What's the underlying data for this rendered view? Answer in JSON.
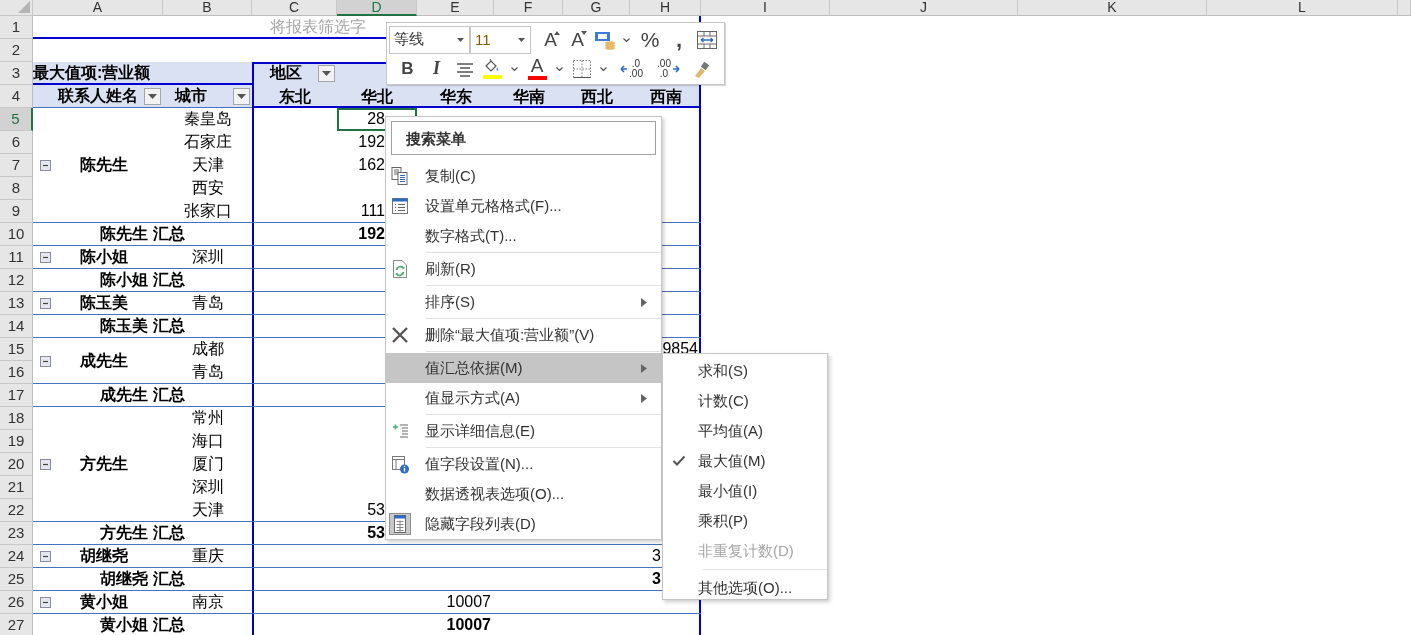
{
  "columns": [
    {
      "label": "A",
      "selected": false
    },
    {
      "label": "B",
      "selected": false
    },
    {
      "label": "C",
      "selected": false
    },
    {
      "label": "D",
      "selected": true
    },
    {
      "label": "E",
      "selected": false
    },
    {
      "label": "F",
      "selected": false
    },
    {
      "label": "G",
      "selected": false
    },
    {
      "label": "H",
      "selected": false
    },
    {
      "label": "I",
      "selected": false
    },
    {
      "label": "J",
      "selected": false
    },
    {
      "label": "K",
      "selected": false
    },
    {
      "label": "L",
      "selected": false
    }
  ],
  "rows": [
    {
      "label": "1",
      "selected": false
    },
    {
      "label": "2",
      "selected": false
    },
    {
      "label": "3",
      "selected": false
    },
    {
      "label": "4",
      "selected": false
    },
    {
      "label": "5",
      "selected": true
    },
    {
      "label": "6",
      "selected": false
    },
    {
      "label": "7",
      "selected": false
    },
    {
      "label": "8",
      "selected": false
    },
    {
      "label": "9",
      "selected": false
    },
    {
      "label": "10",
      "selected": false
    },
    {
      "label": "11",
      "selected": false
    },
    {
      "label": "12",
      "selected": false
    },
    {
      "label": "13",
      "selected": false
    },
    {
      "label": "14",
      "selected": false
    },
    {
      "label": "15",
      "selected": false
    },
    {
      "label": "16",
      "selected": false
    },
    {
      "label": "17",
      "selected": false
    },
    {
      "label": "18",
      "selected": false
    },
    {
      "label": "19",
      "selected": false
    },
    {
      "label": "20",
      "selected": false
    },
    {
      "label": "21",
      "selected": false
    },
    {
      "label": "22",
      "selected": false
    },
    {
      "label": "23",
      "selected": false
    },
    {
      "label": "24",
      "selected": false
    },
    {
      "label": "25",
      "selected": false
    },
    {
      "label": "26",
      "selected": false
    },
    {
      "label": "27",
      "selected": false
    }
  ],
  "pivot": {
    "filter_hint": "将报表筛选字",
    "value_field": "最大值项:营业额",
    "column_field": "地区",
    "row_fields": [
      "联系人姓名",
      "城市"
    ],
    "regions": [
      "东北",
      "华北",
      "华东",
      "华南",
      "西北",
      "西南"
    ],
    "groups": [
      {
        "name": "陈先生",
        "expanded": true,
        "items": [
          {
            "city": "秦皇岛",
            "values": {
              "region_2": "28"
            }
          },
          {
            "city": "石家庄",
            "values": {
              "region_2": "192"
            }
          },
          {
            "city": "天津",
            "values": {
              "region_2": "162"
            }
          },
          {
            "city": "西安"
          },
          {
            "city": "张家口",
            "values": {
              "region_2": "111"
            }
          }
        ],
        "subtotal": {
          "label": "陈先生 汇总",
          "values": {
            "region_2": "192"
          }
        }
      },
      {
        "name": "陈小姐",
        "expanded": true,
        "items": [
          {
            "city": "深圳"
          }
        ],
        "subtotal": {
          "label": "陈小姐 汇总"
        }
      },
      {
        "name": "陈玉美",
        "expanded": true,
        "items": [
          {
            "city": "青岛"
          }
        ],
        "subtotal": {
          "label": "陈玉美 汇总"
        }
      },
      {
        "name": "成先生",
        "expanded": true,
        "items": [
          {
            "city": "成都",
            "values": {
              "region_6": "9854"
            }
          },
          {
            "city": "青岛"
          }
        ],
        "subtotal": {
          "label": "成先生 汇总"
        }
      },
      {
        "name": "方先生",
        "expanded": true,
        "items": [
          {
            "city": "常州"
          },
          {
            "city": "海口"
          },
          {
            "city": "厦门"
          },
          {
            "city": "深圳"
          },
          {
            "city": "天津",
            "values": {
              "region_2": "53"
            }
          }
        ],
        "subtotal": {
          "label": "方先生 汇总",
          "values": {
            "region_2": "53"
          }
        }
      },
      {
        "name": "胡继尧",
        "expanded": true,
        "items": [
          {
            "city": "重庆",
            "values": {
              "region_6": "3"
            }
          }
        ],
        "subtotal": {
          "label": "胡继尧 汇总",
          "values": {
            "region_6": "3"
          }
        }
      },
      {
        "name": "黄小姐",
        "expanded": true,
        "items": [
          {
            "city": "南京",
            "values": {
              "region_3": "10007"
            }
          }
        ],
        "subtotal": {
          "label": "黄小姐 汇总",
          "values": {
            "region_3": "10007"
          }
        }
      }
    ]
  },
  "mini_toolbar": {
    "rows": [
      [
        {
          "kind": "font",
          "value": "等线"
        },
        {
          "kind": "size",
          "value": "11"
        },
        {
          "kind": "grow",
          "glyph": "A"
        },
        {
          "kind": "shrink",
          "glyph": "A"
        },
        {
          "kind": "accounting"
        },
        {
          "kind": "caret"
        },
        {
          "kind": "percent",
          "glyph": "%"
        },
        {
          "kind": "comma",
          "glyph": ","
        },
        {
          "kind": "wrap"
        }
      ],
      [
        {
          "kind": "bold",
          "glyph": "B"
        },
        {
          "kind": "italic",
          "glyph": "I"
        },
        {
          "kind": "align"
        },
        {
          "kind": "fill",
          "color": "#ffff00"
        },
        {
          "kind": "caret"
        },
        {
          "kind": "fontcolor",
          "glyph": "A",
          "color": "#ff0000"
        },
        {
          "kind": "caret"
        },
        {
          "kind": "borders"
        },
        {
          "kind": "caret"
        },
        {
          "kind": "incdecimal",
          "lines": [
            ".0",
            ".00"
          ]
        },
        {
          "kind": "decdecimal",
          "lines": [
            ".00",
            ".0"
          ]
        },
        {
          "kind": "painter"
        }
      ]
    ]
  },
  "context_menu": {
    "search": {
      "placeholder": "搜索菜单"
    },
    "items": [
      {
        "kind": "copy",
        "label": "复制(C)",
        "submenu": false,
        "selected": false,
        "checked": false
      },
      {
        "kind": "format",
        "label": "设置单元格格式(F)...",
        "submenu": false,
        "selected": false,
        "checked": false
      },
      {
        "kind": "plain",
        "label": "数字格式(T)...",
        "submenu": false,
        "selected": false,
        "checked": false
      },
      {
        "kind": "separator"
      },
      {
        "kind": "refresh",
        "label": "刷新(R)",
        "submenu": false,
        "selected": false,
        "checked": false
      },
      {
        "kind": "separator"
      },
      {
        "kind": "plain",
        "label": "排序(S)",
        "submenu": true,
        "selected": false,
        "checked": false
      },
      {
        "kind": "separator"
      },
      {
        "kind": "delete",
        "label": "删除“最大值项:营业额”(V)",
        "submenu": false,
        "selected": false,
        "checked": false
      },
      {
        "kind": "separator"
      },
      {
        "kind": "plain",
        "label": "值汇总依据(M)",
        "submenu": true,
        "selected": true,
        "checked": false
      },
      {
        "kind": "plain",
        "label": "值显示方式(A)",
        "submenu": true,
        "selected": false,
        "checked": false
      },
      {
        "kind": "separator"
      },
      {
        "kind": "details",
        "label": "显示详细信息(E)",
        "submenu": false,
        "selected": false,
        "checked": false
      },
      {
        "kind": "separator"
      },
      {
        "kind": "settings",
        "label": "值字段设置(N)...",
        "submenu": false,
        "selected": false,
        "checked": false
      },
      {
        "kind": "plain",
        "label": "数据透视表选项(O)...",
        "submenu": false,
        "selected": false,
        "checked": false
      },
      {
        "kind": "fieldlist",
        "label": "隐藏字段列表(D)",
        "submenu": false,
        "selected": false,
        "checked": true
      }
    ]
  },
  "submenu": {
    "items": [
      {
        "kind": "item",
        "label": "求和(S)",
        "checked": false,
        "disabled": false
      },
      {
        "kind": "item",
        "label": "计数(C)",
        "checked": false,
        "disabled": false
      },
      {
        "kind": "item",
        "label": "平均值(A)",
        "checked": false,
        "disabled": false
      },
      {
        "kind": "item",
        "label": "最大值(M)",
        "checked": true,
        "disabled": false
      },
      {
        "kind": "item",
        "label": "最小值(I)",
        "checked": false,
        "disabled": false
      },
      {
        "kind": "item",
        "label": "乘积(P)",
        "checked": false,
        "disabled": false
      },
      {
        "kind": "item",
        "label": "非重复计数(D)",
        "checked": false,
        "disabled": true
      },
      {
        "kind": "separator"
      },
      {
        "kind": "item",
        "label": "其他选项(O)...",
        "checked": false,
        "disabled": false
      }
    ]
  }
}
